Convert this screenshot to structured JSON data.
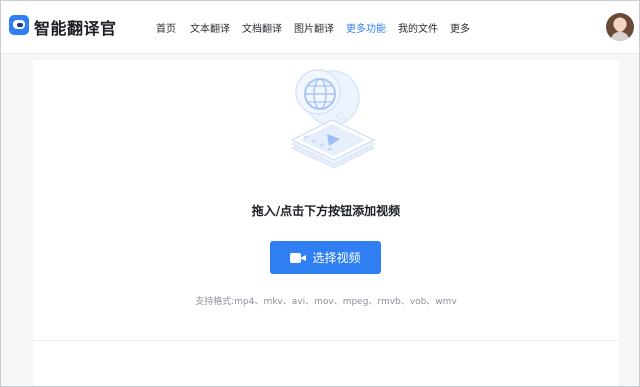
{
  "brand": {
    "name": "智能翻译官",
    "logo_icon": "chat-bubble-icon"
  },
  "nav": {
    "items": [
      {
        "label": "首页",
        "active": false
      },
      {
        "label": "文本翻译",
        "active": false
      },
      {
        "label": "文档翻译",
        "active": false
      },
      {
        "label": "图片翻译",
        "active": false
      },
      {
        "label": "更多功能",
        "active": true
      },
      {
        "label": "我的文件",
        "active": false
      },
      {
        "label": "更多",
        "active": false
      }
    ]
  },
  "upload": {
    "title": "拖入/点击下方按钮添加视频",
    "button_label": "选择视频",
    "button_icon": "video-camera-icon",
    "formats": "支持格式:mp4、mkv、avi、mov、mpeg、rmvb、vob、wmv"
  },
  "colors": {
    "accent": "#2f7ff3",
    "text": "#1b1f24",
    "muted": "#8c9098",
    "page_bg": "#f5f6f8"
  }
}
